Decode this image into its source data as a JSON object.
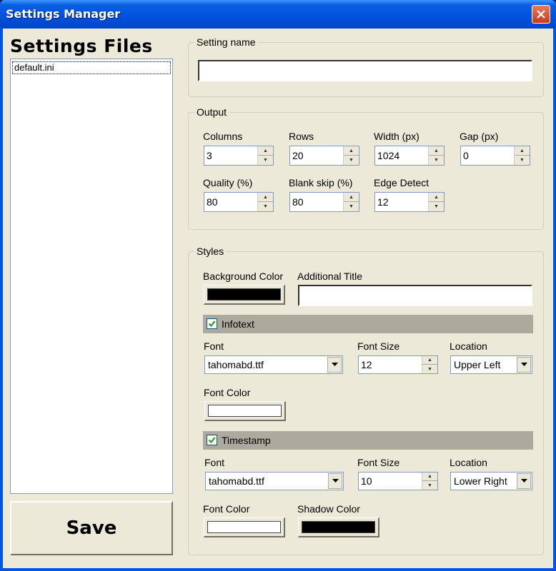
{
  "window": {
    "title": "Settings Manager"
  },
  "left": {
    "title": "Settings Files",
    "files": [
      "default.ini"
    ],
    "save_label": "Save"
  },
  "setting_name": {
    "legend": "Setting name",
    "value": ""
  },
  "output": {
    "legend": "Output",
    "columns": {
      "label": "Columns",
      "value": "3"
    },
    "rows": {
      "label": "Rows",
      "value": "20"
    },
    "width": {
      "label": "Width (px)",
      "value": "1024"
    },
    "gap": {
      "label": "Gap (px)",
      "value": "0"
    },
    "quality": {
      "label": "Quality (%)",
      "value": "80"
    },
    "blank_skip": {
      "label": "Blank skip (%)",
      "value": "80"
    },
    "edge_detect": {
      "label": "Edge Detect",
      "value": "12"
    }
  },
  "styles": {
    "legend": "Styles",
    "background_color": {
      "label": "Background Color",
      "color": "#000000"
    },
    "additional_title": {
      "label": "Additional Title",
      "value": ""
    },
    "infotext": {
      "label": "Infotext",
      "checked": true,
      "font": {
        "label": "Font",
        "value": "tahomabd.ttf"
      },
      "font_size": {
        "label": "Font Size",
        "value": "12"
      },
      "location": {
        "label": "Location",
        "value": "Upper Left"
      },
      "font_color": {
        "label": "Font Color",
        "color": "#ffffff"
      }
    },
    "timestamp": {
      "label": "Timestamp",
      "checked": true,
      "font": {
        "label": "Font",
        "value": "tahomabd.ttf"
      },
      "font_size": {
        "label": "Font Size",
        "value": "10"
      },
      "location": {
        "label": "Location",
        "value": "Lower Right"
      },
      "font_color": {
        "label": "Font Color",
        "color": "#ffffff"
      },
      "shadow_color": {
        "label": "Shadow Color",
        "color": "#000000"
      }
    }
  }
}
